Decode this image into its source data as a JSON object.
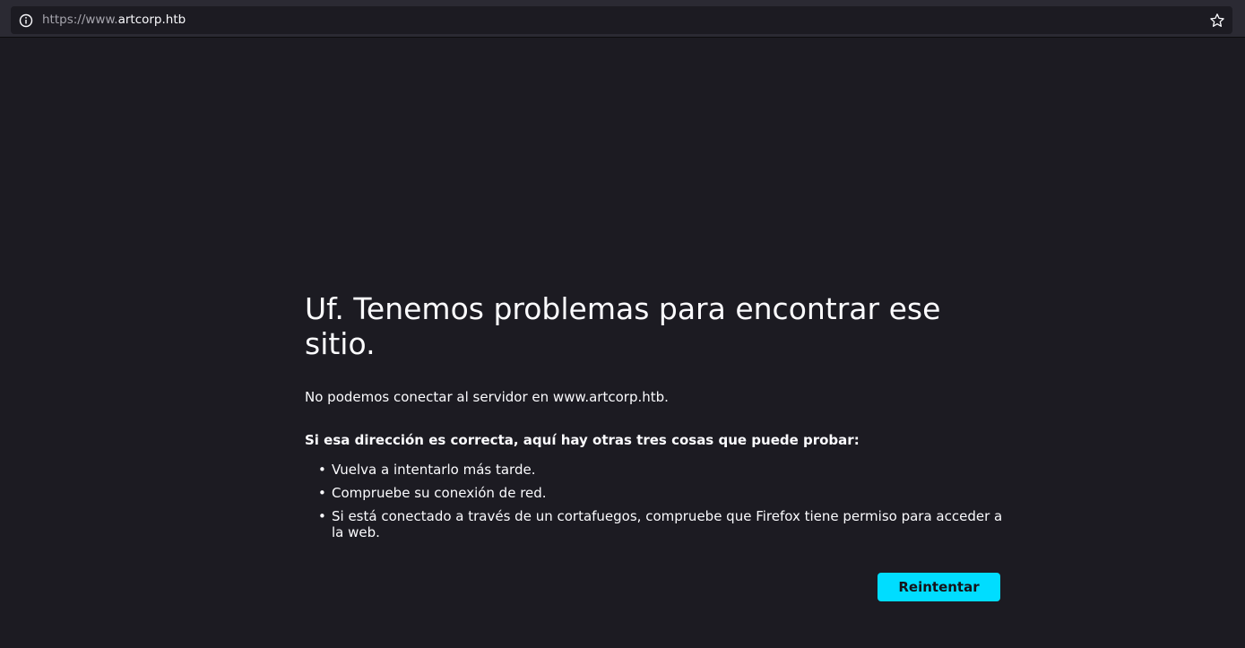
{
  "browser": {
    "url_prefix": "https://www.",
    "url_host": "artcorp.htb",
    "info_icon": "info-icon",
    "bookmark_icon": "star-icon"
  },
  "error_page": {
    "title": "Uf. Tenemos problemas para encontrar ese sitio.",
    "description": "No podemos conectar al servidor en www.artcorp.htb.",
    "subheading": "Si esa dirección es correcta, aquí hay otras tres cosas que puede probar:",
    "tips": [
      "Vuelva a intentarlo más tarde.",
      "Compruebe su conexión de red.",
      "Si está conectado a través de un cortafuegos, compruebe que Firefox tiene permiso para acceder a la web."
    ],
    "retry_label": "Reintentar"
  },
  "colors": {
    "background": "#1c1b22",
    "toolbar": "#2b2a33",
    "text": "#fbfbfe",
    "accent_button": "#00ddff"
  }
}
